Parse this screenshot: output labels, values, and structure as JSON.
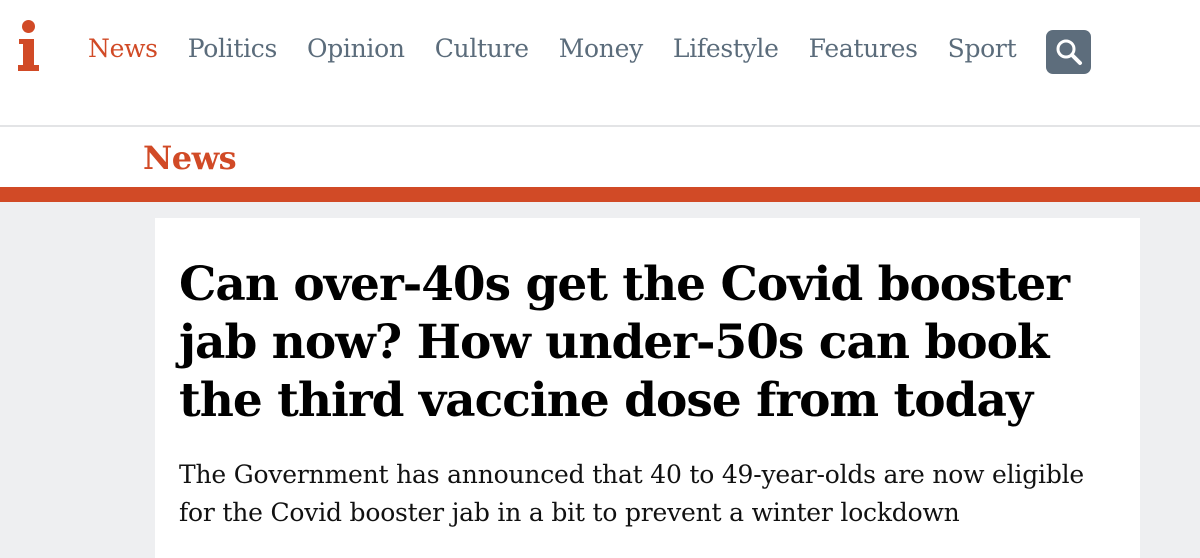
{
  "colors": {
    "accent": "#d14a26",
    "nav_text": "#5b6c7b",
    "search_button": "#5d6d7c"
  },
  "brand": {
    "logo_letter": "i"
  },
  "nav": {
    "items": [
      {
        "label": "News",
        "active": true
      },
      {
        "label": "Politics",
        "active": false
      },
      {
        "label": "Opinion",
        "active": false
      },
      {
        "label": "Culture",
        "active": false
      },
      {
        "label": "Money",
        "active": false
      },
      {
        "label": "Lifestyle",
        "active": false
      },
      {
        "label": "Features",
        "active": false
      },
      {
        "label": "Sport",
        "active": false
      }
    ],
    "search_icon": "search-icon"
  },
  "section": {
    "title": "News"
  },
  "article": {
    "headline": "Can over-40s get the Covid booster jab now? How under-50s can book the third vaccine dose from today",
    "standfirst": "The Government has announced that 40 to 49-year-olds are now eligible for the Covid booster jab in a bit to prevent a winter lockdown"
  }
}
